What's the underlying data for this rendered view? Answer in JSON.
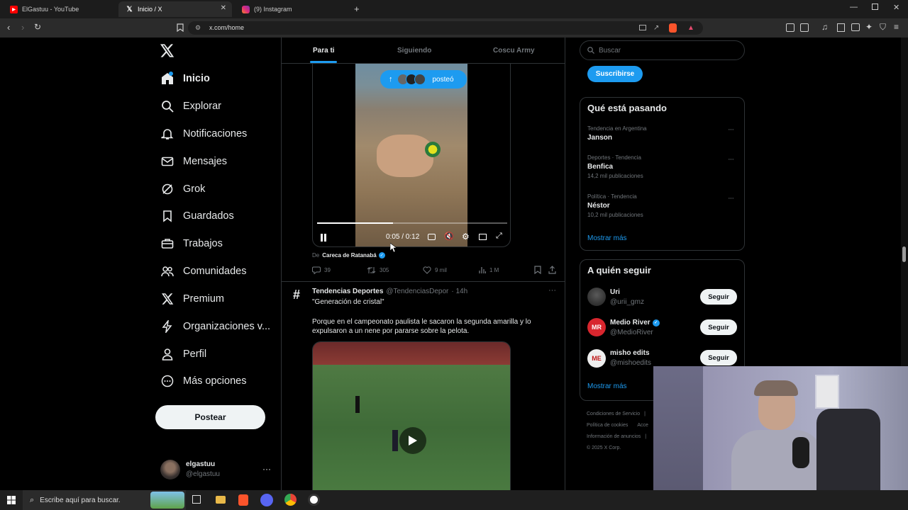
{
  "browser": {
    "tabs": [
      {
        "title": "ElGastuu - YouTube",
        "icon": "youtube-icon"
      },
      {
        "title": "Inicio / X",
        "icon": "x-logo-icon"
      },
      {
        "title": "(9) Instagram",
        "icon": "instagram-icon"
      }
    ],
    "url": "x.com/home"
  },
  "sidebar": {
    "items": [
      {
        "label": "Inicio",
        "icon": "home-icon"
      },
      {
        "label": "Explorar",
        "icon": "search-icon"
      },
      {
        "label": "Notificaciones",
        "icon": "bell-icon"
      },
      {
        "label": "Mensajes",
        "icon": "mail-icon"
      },
      {
        "label": "Grok",
        "icon": "grok-icon"
      },
      {
        "label": "Guardados",
        "icon": "bookmark-icon"
      },
      {
        "label": "Trabajos",
        "icon": "briefcase-icon"
      },
      {
        "label": "Comunidades",
        "icon": "people-icon"
      },
      {
        "label": "Premium",
        "icon": "x-logo-icon"
      },
      {
        "label": "Organizaciones v...",
        "icon": "lightning-icon"
      },
      {
        "label": "Perfil",
        "icon": "person-icon"
      },
      {
        "label": "Más opciones",
        "icon": "more-circle-icon"
      }
    ],
    "post_button": "Postear",
    "account": {
      "name": "elgastuu",
      "handle": "@elgastuu"
    }
  },
  "feed": {
    "tabs": [
      "Para ti",
      "Siguiendo",
      "Coscu Army"
    ],
    "posted_pill": "posteó",
    "video": {
      "time": "0:05 / 0:12",
      "progress": 0.4
    },
    "credit": {
      "prefix": "De",
      "name": "Careca de Ratanabá"
    },
    "stats": {
      "replies": "39",
      "reposts": "305",
      "likes": "9 mil",
      "views": "1 M"
    },
    "post2": {
      "author": "Tendencias Deportes",
      "handle": "@TendenciasDepor",
      "time": "· 14h",
      "line1": "\"Generación de cristal\"",
      "body": "Porque en el campeonato paulista le sacaron la segunda amarilla y lo expulsaron a un nene por pararse sobre la pelota."
    }
  },
  "right": {
    "search_placeholder": "Buscar",
    "subscribe": "Suscribirse",
    "trends_title": "Qué está pasando",
    "trends": [
      {
        "meta": "Tendencia en Argentina",
        "name": "Janson",
        "posts": ""
      },
      {
        "meta": "Deportes · Tendencia",
        "name": "Benfica",
        "posts": "14,2 mil publicaciones"
      },
      {
        "meta": "Política · Tendencia",
        "name": "Néstor",
        "posts": "10,2 mil publicaciones"
      }
    ],
    "show_more": "Mostrar más",
    "follow_title": "A quién seguir",
    "follow": [
      {
        "name": "Uri",
        "handle": "@urii_gmz",
        "verified": false
      },
      {
        "name": "Medio River",
        "handle": "@MedioRiver",
        "verified": true
      },
      {
        "name": "misho edits",
        "handle": "@mishoedits",
        "verified": false
      }
    ],
    "follow_button": "Seguir",
    "show_more2": "Mostrar más",
    "footer": [
      "Condiciones de Servicio",
      "|",
      "Política de cookies",
      "Acce",
      "Información de anuncios",
      "|",
      "© 2025 X Corp."
    ]
  },
  "taskbar": {
    "search_placeholder": "Escribe aquí para buscar."
  },
  "colors": {
    "accent": "#1d9bf0",
    "background": "#000000",
    "border": "#2f3336",
    "muted": "#71767b"
  }
}
